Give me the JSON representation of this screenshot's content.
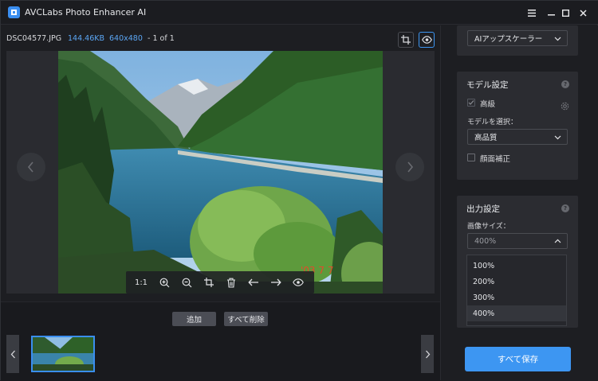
{
  "window": {
    "title": "AVCLabs Photo Enhancer AI",
    "menu_icon": "hamburger-menu-icon",
    "controls": [
      "minimize-icon",
      "maximize-icon",
      "close-icon"
    ]
  },
  "file_info": {
    "name": "DSC04577.JPG",
    "size": "144.46KB",
    "resolution": "640x480",
    "count": "- 1 of 1"
  },
  "viewer": {
    "photo_stamp": "'03  7  7",
    "toolbar": {
      "ratio_label": "1:1",
      "icons": [
        "zoom-in-icon",
        "zoom-out-icon",
        "crop-icon",
        "delete-icon",
        "arrow-left-icon",
        "arrow-right-icon",
        "eye-icon"
      ]
    }
  },
  "bottom": {
    "add_label": "追加",
    "delete_all_label": "すべて削除"
  },
  "right_panel": {
    "model_select_top": "AIアップスケーラー",
    "model_settings": {
      "title": "モデル設定",
      "high_label": "高級",
      "high_checked": true,
      "choose_model_label": "モデルを選択：",
      "model_value": "高品質",
      "face_label": "顔面補正",
      "face_checked": false
    },
    "output_settings": {
      "title": "出力設定",
      "image_size_label": "画像サイズ：",
      "image_size_value": "400%",
      "options": [
        "100%",
        "200%",
        "300%",
        "400%"
      ],
      "selected_option": "400%"
    },
    "save_all_label": "すべて保存"
  },
  "colors": {
    "accent": "#3d96f2",
    "link": "#5ba6f4",
    "panel": "#2b2c31",
    "background": "#1d1e22"
  }
}
